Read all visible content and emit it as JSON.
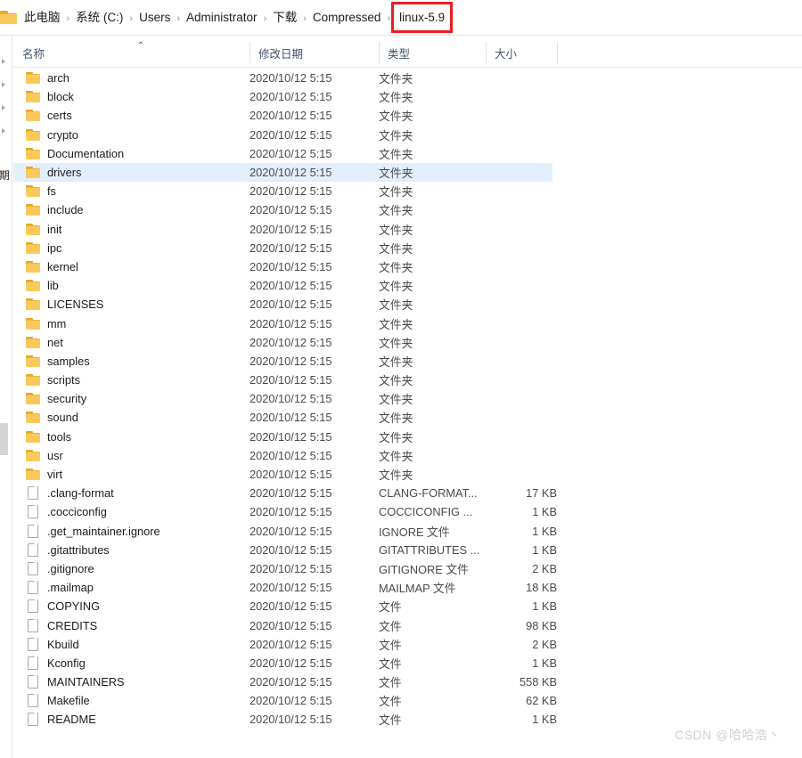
{
  "breadcrumb": {
    "folder_icon": "folder-icon",
    "separator": "›",
    "items": [
      {
        "label": "此电脑"
      },
      {
        "label": "系统 (C:)"
      },
      {
        "label": "Users"
      },
      {
        "label": "Administrator"
      },
      {
        "label": "下载"
      },
      {
        "label": "Compressed"
      }
    ],
    "current": "linux-5.9",
    "highlight_color": "#ee1c24"
  },
  "left_rail": {
    "partial_glyph": "期",
    "chevron_count": 4
  },
  "columns": {
    "name": "名称",
    "date_modified": "修改日期",
    "type": "类型",
    "size": "大小",
    "sort_caret": "⌃",
    "sort_column": "名称",
    "sort_direction": "ascending"
  },
  "selection": {
    "color": "#e2eefb",
    "selected_name": "drivers"
  },
  "rows": [
    {
      "icon": "folder-icon",
      "name": "arch",
      "date": "2020/10/12 5:15",
      "type": "文件夹",
      "size": "",
      "selected": false
    },
    {
      "icon": "folder-icon",
      "name": "block",
      "date": "2020/10/12 5:15",
      "type": "文件夹",
      "size": "",
      "selected": false
    },
    {
      "icon": "folder-icon",
      "name": "certs",
      "date": "2020/10/12 5:15",
      "type": "文件夹",
      "size": "",
      "selected": false
    },
    {
      "icon": "folder-icon",
      "name": "crypto",
      "date": "2020/10/12 5:15",
      "type": "文件夹",
      "size": "",
      "selected": false
    },
    {
      "icon": "folder-icon",
      "name": "Documentation",
      "date": "2020/10/12 5:15",
      "type": "文件夹",
      "size": "",
      "selected": false
    },
    {
      "icon": "folder-icon",
      "name": "drivers",
      "date": "2020/10/12 5:15",
      "type": "文件夹",
      "size": "",
      "selected": true
    },
    {
      "icon": "folder-icon",
      "name": "fs",
      "date": "2020/10/12 5:15",
      "type": "文件夹",
      "size": "",
      "selected": false
    },
    {
      "icon": "folder-icon",
      "name": "include",
      "date": "2020/10/12 5:15",
      "type": "文件夹",
      "size": "",
      "selected": false
    },
    {
      "icon": "folder-icon",
      "name": "init",
      "date": "2020/10/12 5:15",
      "type": "文件夹",
      "size": "",
      "selected": false
    },
    {
      "icon": "folder-icon",
      "name": "ipc",
      "date": "2020/10/12 5:15",
      "type": "文件夹",
      "size": "",
      "selected": false
    },
    {
      "icon": "folder-icon",
      "name": "kernel",
      "date": "2020/10/12 5:15",
      "type": "文件夹",
      "size": "",
      "selected": false
    },
    {
      "icon": "folder-icon",
      "name": "lib",
      "date": "2020/10/12 5:15",
      "type": "文件夹",
      "size": "",
      "selected": false
    },
    {
      "icon": "folder-icon",
      "name": "LICENSES",
      "date": "2020/10/12 5:15",
      "type": "文件夹",
      "size": "",
      "selected": false
    },
    {
      "icon": "folder-icon",
      "name": "mm",
      "date": "2020/10/12 5:15",
      "type": "文件夹",
      "size": "",
      "selected": false
    },
    {
      "icon": "folder-icon",
      "name": "net",
      "date": "2020/10/12 5:15",
      "type": "文件夹",
      "size": "",
      "selected": false
    },
    {
      "icon": "folder-icon",
      "name": "samples",
      "date": "2020/10/12 5:15",
      "type": "文件夹",
      "size": "",
      "selected": false
    },
    {
      "icon": "folder-icon",
      "name": "scripts",
      "date": "2020/10/12 5:15",
      "type": "文件夹",
      "size": "",
      "selected": false
    },
    {
      "icon": "folder-icon",
      "name": "security",
      "date": "2020/10/12 5:15",
      "type": "文件夹",
      "size": "",
      "selected": false
    },
    {
      "icon": "folder-icon",
      "name": "sound",
      "date": "2020/10/12 5:15",
      "type": "文件夹",
      "size": "",
      "selected": false
    },
    {
      "icon": "folder-icon",
      "name": "tools",
      "date": "2020/10/12 5:15",
      "type": "文件夹",
      "size": "",
      "selected": false
    },
    {
      "icon": "folder-icon",
      "name": "usr",
      "date": "2020/10/12 5:15",
      "type": "文件夹",
      "size": "",
      "selected": false
    },
    {
      "icon": "folder-icon",
      "name": "virt",
      "date": "2020/10/12 5:15",
      "type": "文件夹",
      "size": "",
      "selected": false
    },
    {
      "icon": "file-icon",
      "name": ".clang-format",
      "date": "2020/10/12 5:15",
      "type": "CLANG-FORMAT...",
      "size": "17 KB",
      "selected": false
    },
    {
      "icon": "file-icon",
      "name": ".cocciconfig",
      "date": "2020/10/12 5:15",
      "type": "COCCICONFIG ...",
      "size": "1 KB",
      "selected": false
    },
    {
      "icon": "file-icon",
      "name": ".get_maintainer.ignore",
      "date": "2020/10/12 5:15",
      "type": "IGNORE 文件",
      "size": "1 KB",
      "selected": false
    },
    {
      "icon": "file-icon",
      "name": ".gitattributes",
      "date": "2020/10/12 5:15",
      "type": "GITATTRIBUTES ...",
      "size": "1 KB",
      "selected": false
    },
    {
      "icon": "file-icon",
      "name": ".gitignore",
      "date": "2020/10/12 5:15",
      "type": "GITIGNORE 文件",
      "size": "2 KB",
      "selected": false
    },
    {
      "icon": "file-icon",
      "name": ".mailmap",
      "date": "2020/10/12 5:15",
      "type": "MAILMAP 文件",
      "size": "18 KB",
      "selected": false
    },
    {
      "icon": "file-icon",
      "name": "COPYING",
      "date": "2020/10/12 5:15",
      "type": "文件",
      "size": "1 KB",
      "selected": false
    },
    {
      "icon": "file-icon",
      "name": "CREDITS",
      "date": "2020/10/12 5:15",
      "type": "文件",
      "size": "98 KB",
      "selected": false
    },
    {
      "icon": "file-icon",
      "name": "Kbuild",
      "date": "2020/10/12 5:15",
      "type": "文件",
      "size": "2 KB",
      "selected": false
    },
    {
      "icon": "file-icon",
      "name": "Kconfig",
      "date": "2020/10/12 5:15",
      "type": "文件",
      "size": "1 KB",
      "selected": false
    },
    {
      "icon": "file-icon",
      "name": "MAINTAINERS",
      "date": "2020/10/12 5:15",
      "type": "文件",
      "size": "558 KB",
      "selected": false
    },
    {
      "icon": "file-icon",
      "name": "Makefile",
      "date": "2020/10/12 5:15",
      "type": "文件",
      "size": "62 KB",
      "selected": false
    },
    {
      "icon": "file-icon",
      "name": "README",
      "date": "2020/10/12 5:15",
      "type": "文件",
      "size": "1 KB",
      "selected": false
    }
  ],
  "watermark": "CSDN @哈哈浩丶"
}
